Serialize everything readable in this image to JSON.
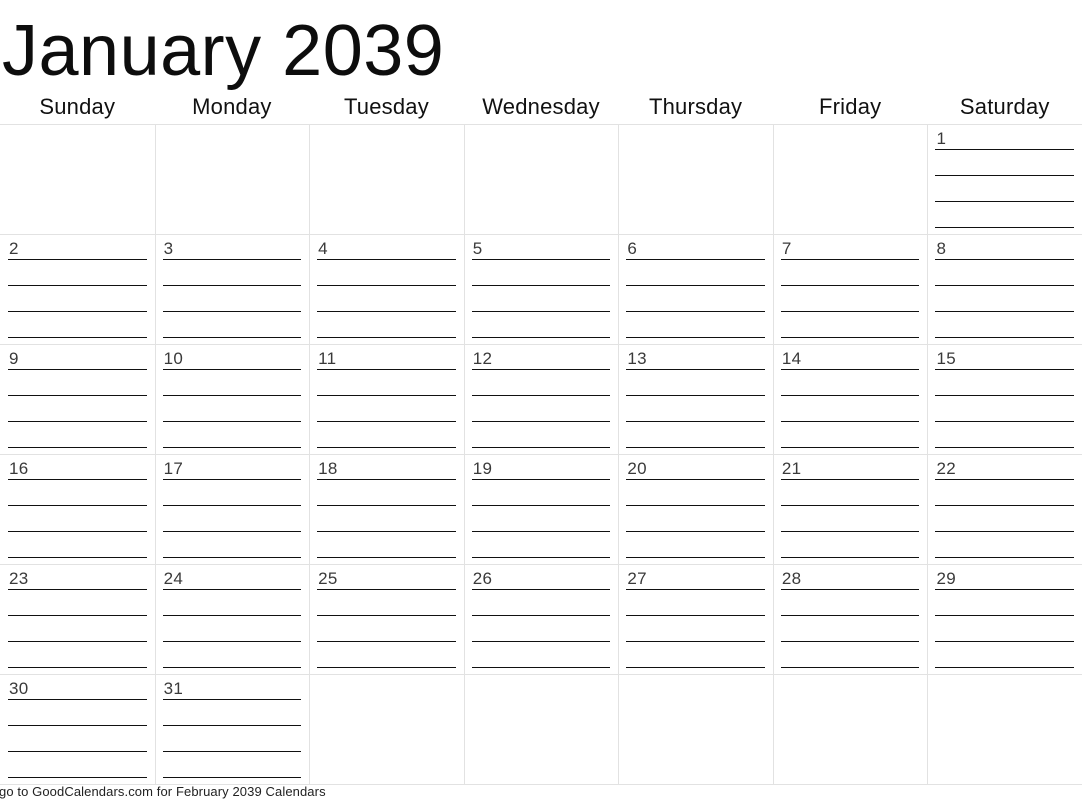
{
  "header": {
    "title": "January 2039",
    "month": "January",
    "year": "2039"
  },
  "weekdays": [
    {
      "label": "Sunday"
    },
    {
      "label": "Monday"
    },
    {
      "label": "Tuesday"
    },
    {
      "label": "Wednesday"
    },
    {
      "label": "Thursday"
    },
    {
      "label": "Friday"
    },
    {
      "label": "Saturday"
    }
  ],
  "grid": {
    "lines_per_day": 4,
    "weeks": [
      {
        "days": [
          {
            "date": ""
          },
          {
            "date": ""
          },
          {
            "date": ""
          },
          {
            "date": ""
          },
          {
            "date": ""
          },
          {
            "date": ""
          },
          {
            "date": "1"
          }
        ]
      },
      {
        "days": [
          {
            "date": "2"
          },
          {
            "date": "3"
          },
          {
            "date": "4"
          },
          {
            "date": "5"
          },
          {
            "date": "6"
          },
          {
            "date": "7"
          },
          {
            "date": "8"
          }
        ]
      },
      {
        "days": [
          {
            "date": "9"
          },
          {
            "date": "10"
          },
          {
            "date": "11"
          },
          {
            "date": "12"
          },
          {
            "date": "13"
          },
          {
            "date": "14"
          },
          {
            "date": "15"
          }
        ]
      },
      {
        "days": [
          {
            "date": "16"
          },
          {
            "date": "17"
          },
          {
            "date": "18"
          },
          {
            "date": "19"
          },
          {
            "date": "20"
          },
          {
            "date": "21"
          },
          {
            "date": "22"
          }
        ]
      },
      {
        "days": [
          {
            "date": "23"
          },
          {
            "date": "24"
          },
          {
            "date": "25"
          },
          {
            "date": "26"
          },
          {
            "date": "27"
          },
          {
            "date": "28"
          },
          {
            "date": "29"
          }
        ]
      },
      {
        "days": [
          {
            "date": "30"
          },
          {
            "date": "31"
          },
          {
            "date": ""
          },
          {
            "date": ""
          },
          {
            "date": ""
          },
          {
            "date": ""
          },
          {
            "date": ""
          }
        ]
      }
    ]
  },
  "footer": {
    "text": "go to GoodCalendars.com for February 2039 Calendars"
  },
  "colors": {
    "grid_line": "#e2e2e2",
    "rule_line": "#111111",
    "date_text": "#3a3a3a",
    "title_text": "#0d0d0d",
    "background": "#ffffff"
  }
}
